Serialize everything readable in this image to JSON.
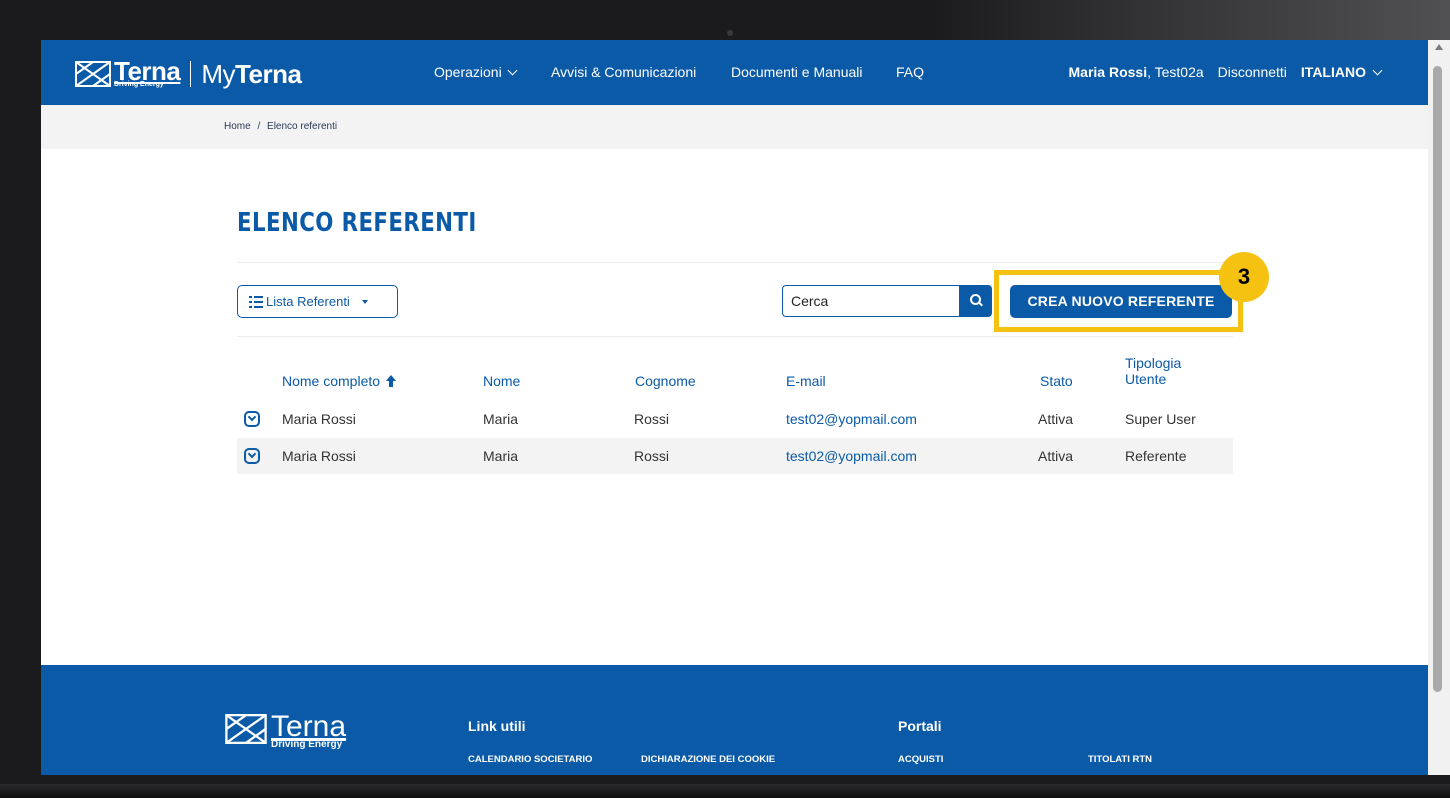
{
  "header": {
    "brand": {
      "logo_text": "Terna",
      "tagline": "Driving Energy",
      "portal_prefix": "My",
      "portal_name": "Terna"
    },
    "nav": [
      {
        "label": "Operazioni",
        "has_dropdown": true
      },
      {
        "label": "Avvisi & Comunicazioni"
      },
      {
        "label": "Documenti e Manuali"
      },
      {
        "label": "FAQ"
      }
    ],
    "user": {
      "name": "Maria Rossi",
      "account": ", Test02a"
    },
    "logout_label": "Disconnetti",
    "language": "ITALIANO"
  },
  "breadcrumb": {
    "home": "Home",
    "separator": "/",
    "current": "Elenco referenti"
  },
  "page": {
    "title": "ELENCO REFERENTI"
  },
  "toolbar": {
    "view_dropdown": "Lista Referenti",
    "search_placeholder": "Cerca",
    "create_button": "CREA NUOVO REFERENTE",
    "step_badge": "3"
  },
  "table": {
    "columns": [
      "Nome completo",
      "Nome",
      "Cognome",
      "E-mail",
      "Stato",
      "Tipologia",
      "Utente"
    ],
    "sort_column": "Nome completo",
    "rows": [
      {
        "full_name": "Maria Rossi",
        "first_name": "Maria",
        "last_name": "Rossi",
        "email": "test02@yopmail.com",
        "status": "Attiva",
        "type": "Super User"
      },
      {
        "full_name": "Maria Rossi",
        "first_name": "Maria",
        "last_name": "Rossi",
        "email": "test02@yopmail.com",
        "status": "Attiva",
        "type": "Referente"
      }
    ]
  },
  "footer": {
    "logo_text": "Terna",
    "tagline": "Driving Energy",
    "sections": [
      {
        "title": "Link utili",
        "links": [
          "CALENDARIO SOCIETARIO",
          "DICHIARAZIONE DEI COOKIE"
        ]
      },
      {
        "title": "Portali",
        "links": [
          "ACQUISTI",
          "TITOLATI RTN"
        ]
      }
    ]
  },
  "colors": {
    "brand_blue": "#0b5aa8",
    "highlight_yellow": "#f6c212",
    "breadcrumb_bg": "#f3f3f3"
  },
  "icons": [
    "terna-logo-icon",
    "chevron-down-icon",
    "list-icon",
    "caret-down-icon",
    "search-icon",
    "sort-up-icon",
    "expand-row-icon"
  ]
}
